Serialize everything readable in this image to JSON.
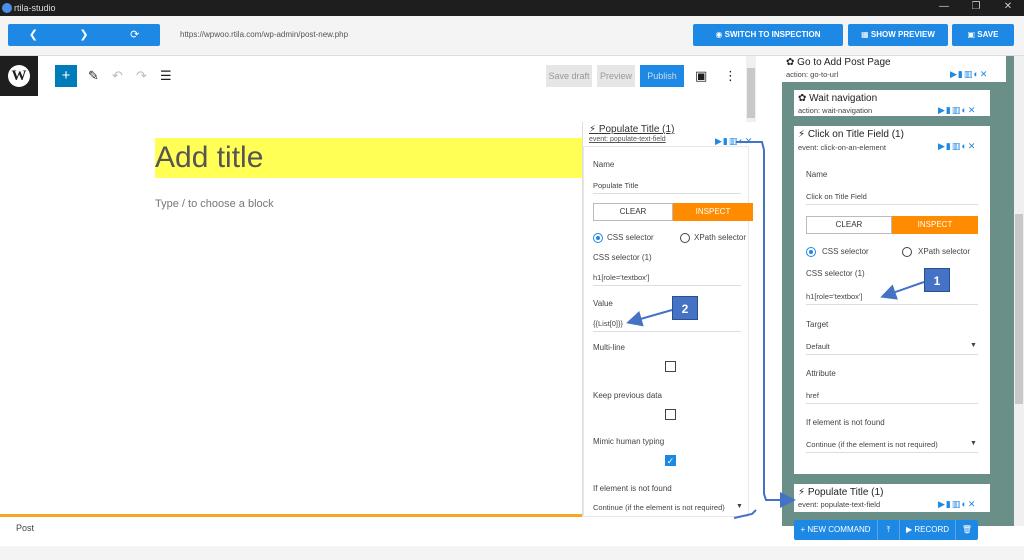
{
  "window": {
    "title": "rtila-studio",
    "controls": [
      "—",
      "❐",
      "✕"
    ]
  },
  "toolbar": {
    "back": "❮",
    "forward": "❯",
    "reload": "⟳",
    "url": "https://wpwoo.rtila.com/wp-admin/post-new.php",
    "switch_label": "SWITCH TO INSPECTION",
    "preview_label": "SHOW PREVIEW",
    "save_label": "SAVE"
  },
  "wp": {
    "logo": "W",
    "add_icon": "+",
    "pen_icon": "✎",
    "undo_icon": "↶",
    "redo_icon": "↷",
    "list_icon": "☰",
    "save_draft": "Save draft",
    "preview": "Preview",
    "publish": "Publish",
    "title_placeholder": "Add title",
    "block_hint": "Type / to choose a block",
    "footer_label": "Post",
    "sidebar_icon": "▣",
    "more_icon": "⋮"
  },
  "populate": {
    "title": "Populate Title (1)",
    "event": "event:  populate-text-field",
    "icons": "▶▮▥◐✕",
    "name_label": "Name",
    "name_value": "Populate Title",
    "clear": "CLEAR",
    "inspect": "INSPECT",
    "css_label": "CSS selector",
    "xpath_label": "XPath selector",
    "css_selector_label": "CSS selector (1)",
    "css_selector_value": "h1[role='textbox']",
    "value_label": "Value",
    "value_value": "{{List[0]}}",
    "multiline_label": "Multi-line",
    "keep_label": "Keep previous data",
    "mimic_label": "Mimic human typing",
    "notfound_label": "If element is not found",
    "notfound_value": "Continue (if the element is not required)"
  },
  "steps": {
    "goto": {
      "title": "Go to Add Post Page",
      "action": "action:  go-to-url"
    },
    "wait": {
      "title": "Wait navigation",
      "action": "action:  wait-navigation"
    },
    "click": {
      "title": "Click on Title Field (1)",
      "event": "event:  click-on-an-element",
      "name_label": "Name",
      "name_value": "Click on Title Field",
      "clear": "CLEAR",
      "inspect": "INSPECT",
      "css_label": "CSS selector",
      "xpath_label": "XPath selector",
      "css_selector_label": "CSS selector (1)",
      "css_selector_value": "h1[role='textbox']",
      "target_label": "Target",
      "target_value": "Default",
      "attribute_label": "Attribute",
      "attribute_value": "href",
      "notfound_label": "If element is not found",
      "notfound_value": "Continue (if the element is not required)"
    },
    "populate": {
      "title": "Populate Title (1)",
      "event": "event:  populate-text-field"
    },
    "icons": "▶▮▥◐✕",
    "gear_icon": "✿",
    "bolt_icon": "⚡"
  },
  "commands": {
    "new_command": "+ NEW COMMAND",
    "upload": "⤒",
    "record": "▶ RECORD",
    "delete": "🗑"
  },
  "badges": {
    "one": "1",
    "two": "2"
  },
  "colors": {
    "accent": "#1e88e5",
    "inspect": "#ff8c00",
    "title_highlight": "#ffff55",
    "footer_line": "#f5a623"
  }
}
